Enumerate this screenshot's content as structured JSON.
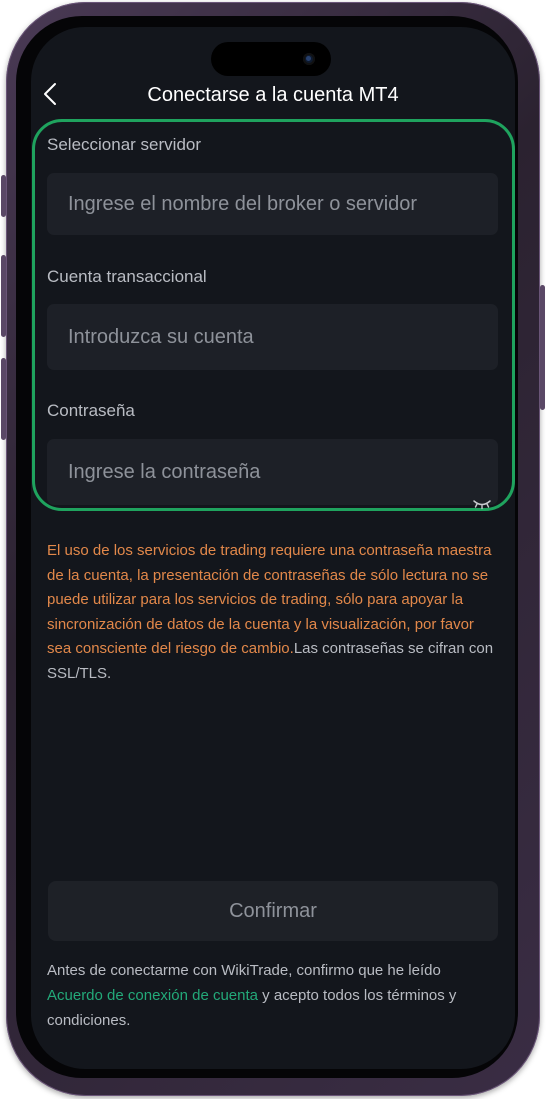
{
  "header": {
    "title": "Conectarse a la cuenta MT4",
    "back_icon": "chevron-left-icon"
  },
  "form": {
    "server": {
      "label": "Seleccionar servidor",
      "placeholder": "Ingrese el nombre del broker o servidor"
    },
    "account": {
      "label": "Cuenta transaccional",
      "placeholder": "Introduzca su cuenta"
    },
    "password": {
      "label": "Contraseña",
      "placeholder": "Ingrese la contraseña",
      "toggle_icon": "eye-closed-icon"
    },
    "highlight_color": "#1fa35e"
  },
  "notice": {
    "warning_text": "El uso de los servicios de trading requiere una contraseña maestra de la cuenta, la presentación de contraseñas de sólo lectura no se puede utilizar para los servicios de trading, sólo para apoyar la sincronización de datos de la cuenta y la visualización, por favor sea consciente del riesgo de cambio.",
    "info_text": "Las contraseñas se cifran con SSL/TLS.",
    "warning_color": "#e2884a"
  },
  "confirm": {
    "label": "Confirmar"
  },
  "agreement": {
    "prefix": "Antes de conectarme con WikiTrade, confirmo que he leído ",
    "link_text": "Acuerdo de conexión de cuenta",
    "suffix": " y acepto todos los términos y condiciones.",
    "link_color": "#23a979"
  },
  "colors": {
    "background": "#13161c",
    "input_background": "#1d2027"
  }
}
